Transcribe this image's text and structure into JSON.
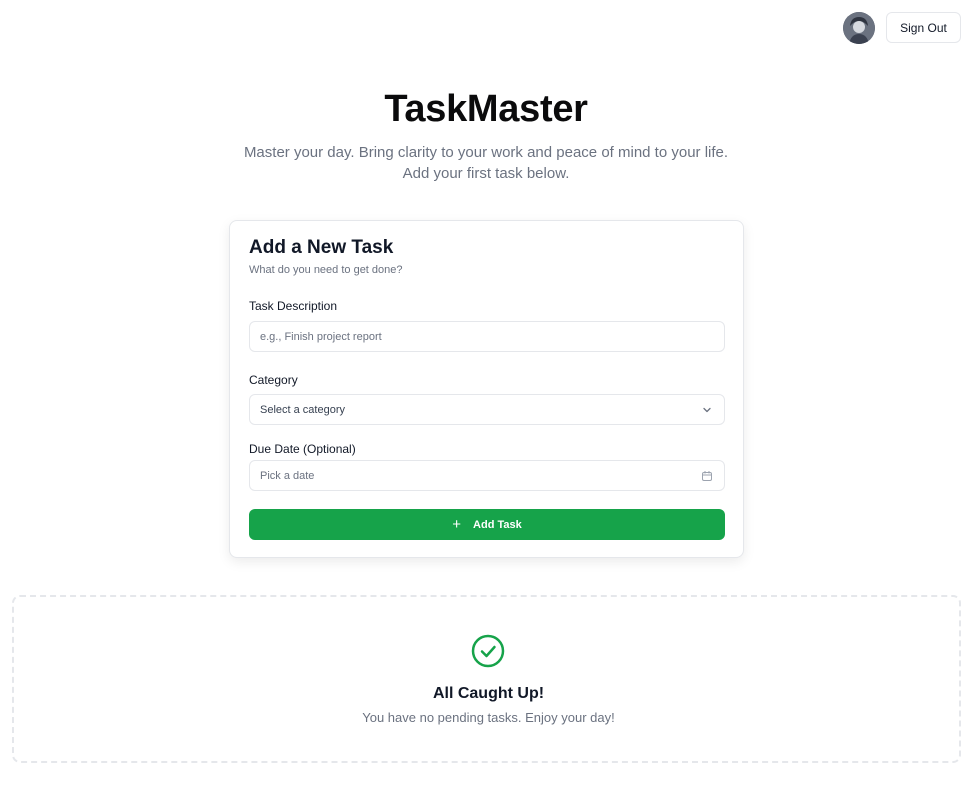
{
  "header": {
    "avatar_icon": "user-avatar",
    "signout_label": "Sign Out"
  },
  "hero": {
    "title": "TaskMaster",
    "subtitle_line1": "Master your day. Bring clarity to your work and peace of mind to your life.",
    "subtitle_line2": "Add your first task below."
  },
  "form": {
    "title": "Add a New Task",
    "subtitle": "What do you need to get done?",
    "description_label": "Task Description",
    "description_placeholder": "e.g., Finish project report",
    "description_value": "",
    "category_label": "Category",
    "category_value": "Select a category",
    "category_icon": "chevron-down-icon",
    "due_label": "Due Date (Optional)",
    "due_value": "Pick a date",
    "due_icon": "calendar-icon",
    "submit_label": "Add Task",
    "submit_icon": "plus-icon"
  },
  "empty_state": {
    "icon": "check-circle-icon",
    "title": "All Caught Up!",
    "subtitle": "You have no pending tasks. Enjoy your day!"
  },
  "colors": {
    "accent": "#16a34a",
    "muted_text": "#6b7280",
    "border": "#e5e7eb"
  }
}
